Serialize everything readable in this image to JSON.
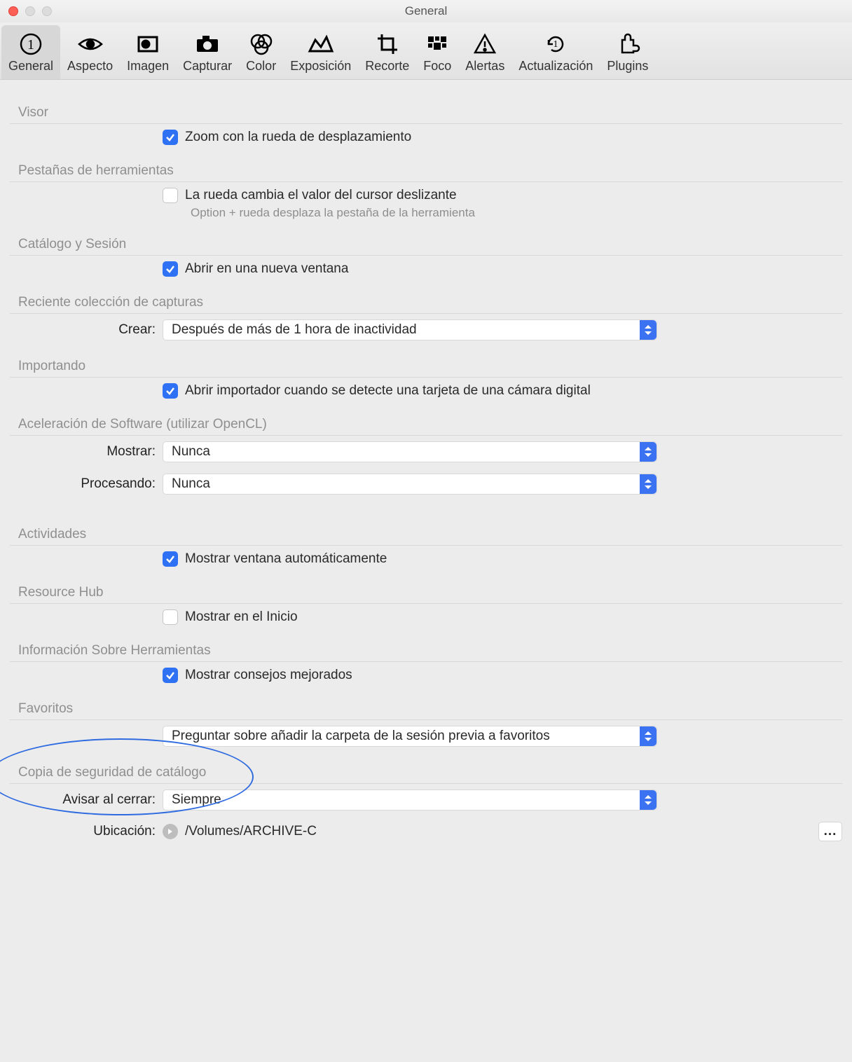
{
  "window": {
    "title": "General"
  },
  "tabs": [
    {
      "id": "general",
      "label": "General",
      "active": true
    },
    {
      "id": "aspecto",
      "label": "Aspecto"
    },
    {
      "id": "imagen",
      "label": "Imagen"
    },
    {
      "id": "capturar",
      "label": "Capturar"
    },
    {
      "id": "color",
      "label": "Color"
    },
    {
      "id": "exposicion",
      "label": "Exposición"
    },
    {
      "id": "recorte",
      "label": "Recorte"
    },
    {
      "id": "foco",
      "label": "Foco"
    },
    {
      "id": "alertas",
      "label": "Alertas"
    },
    {
      "id": "actualizacion",
      "label": "Actualización"
    },
    {
      "id": "plugins",
      "label": "Plugins"
    }
  ],
  "sections": {
    "visor": {
      "title": "Visor",
      "zoom_scroll": {
        "checked": true,
        "label": "Zoom con la rueda de desplazamiento"
      }
    },
    "tool_tabs": {
      "title": "Pestañas de herramientas",
      "wheel_slider": {
        "checked": false,
        "label": "La rueda cambia el valor del cursor deslizante"
      },
      "hint": "Option + rueda desplaza la pestaña de la herramienta"
    },
    "catalog_session": {
      "title": "Catálogo y Sesión",
      "open_new": {
        "checked": true,
        "label": "Abrir en una nueva ventana"
      }
    },
    "recent": {
      "title": "Reciente colección de capturas",
      "create_label": "Crear:",
      "create_value": "Después de más de 1 hora de inactividad"
    },
    "importing": {
      "title": "Importando",
      "open_importer": {
        "checked": true,
        "label": "Abrir importador cuando se detecte una tarjeta de una cámara digital"
      }
    },
    "opencl": {
      "title": "Aceleración de Software (utilizar OpenCL)",
      "show_label": "Mostrar:",
      "show_value": "Nunca",
      "proc_label": "Procesando:",
      "proc_value": "Nunca"
    },
    "activities": {
      "title": "Actividades",
      "auto_window": {
        "checked": true,
        "label": "Mostrar ventana automáticamente"
      }
    },
    "resource_hub": {
      "title": "Resource Hub",
      "show_start": {
        "checked": false,
        "label": "Mostrar en el Inicio"
      }
    },
    "tooltips": {
      "title": "Información Sobre Herramientas",
      "enhanced": {
        "checked": true,
        "label": "Mostrar consejos mejorados"
      }
    },
    "favorites": {
      "title": "Favoritos",
      "value": "Preguntar sobre añadir la carpeta de la sesión previa a favoritos"
    },
    "backup": {
      "title": "Copia de seguridad de catálogo",
      "close_label": "Avisar al cerrar:",
      "close_value": "Siempre",
      "loc_label": "Ubicación:",
      "loc_value": "/Volumes/ARCHIVE-C",
      "browse": "..."
    }
  }
}
